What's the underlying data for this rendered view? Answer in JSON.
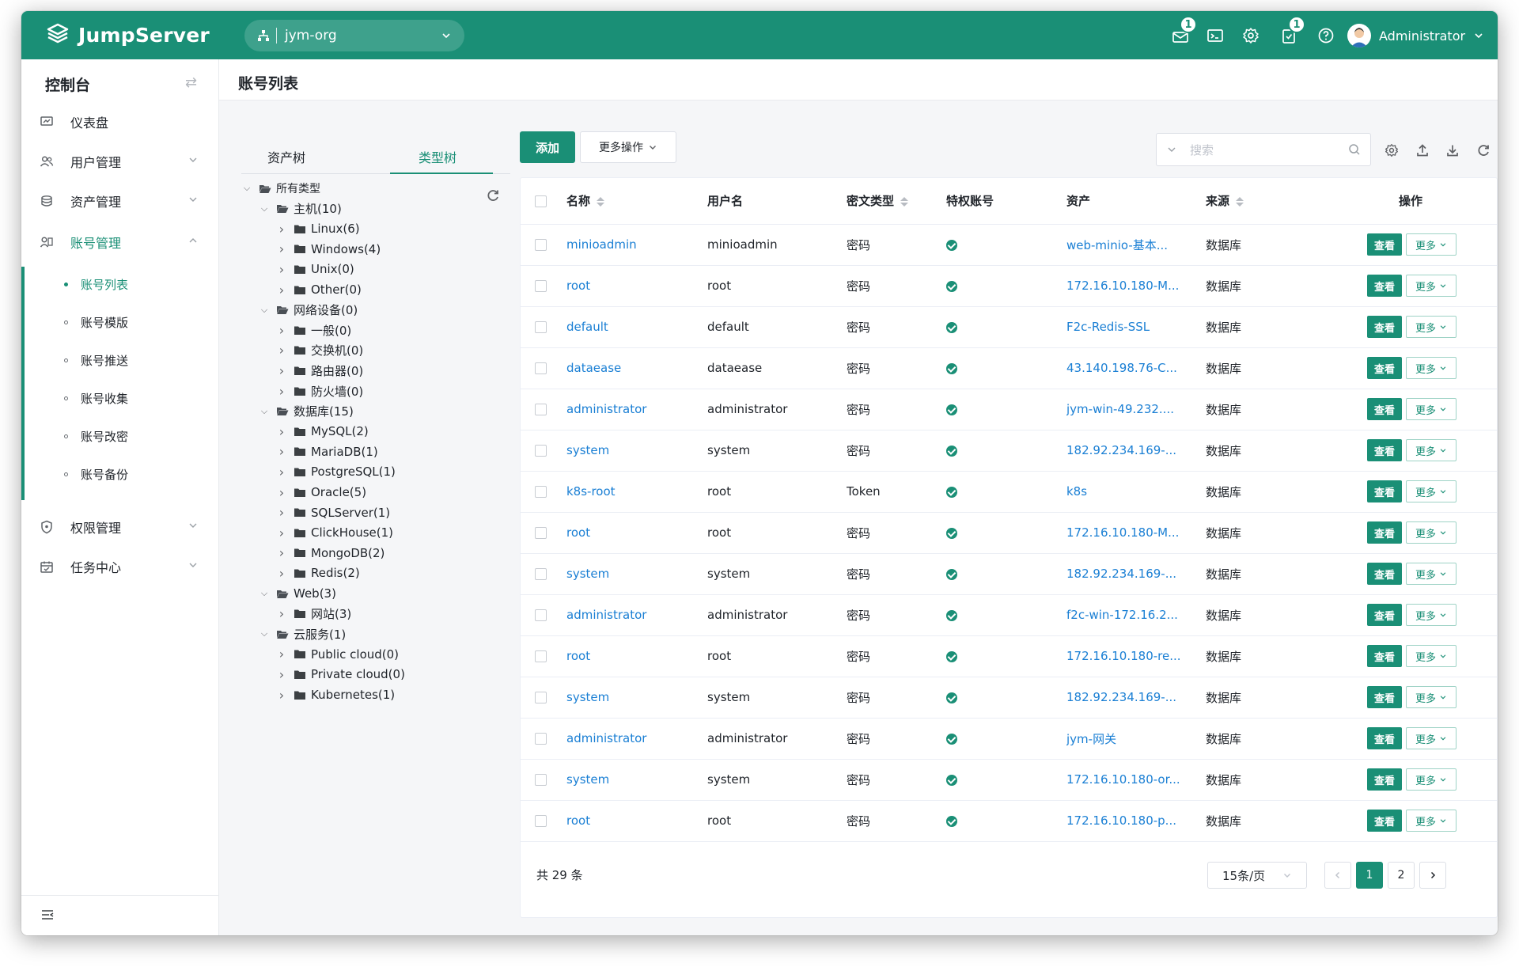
{
  "app": {
    "brand": "JumpServer",
    "org": "jym-org",
    "notifications": {
      "messages_badge": "1",
      "tasks_badge": "1"
    },
    "user": "Administrator",
    "accent": "#1a8f76"
  },
  "sidebar": {
    "title": "控制台",
    "items": [
      {
        "label": "仪表盘",
        "icon": "dashboard-icon"
      },
      {
        "label": "用户管理",
        "icon": "users-icon"
      },
      {
        "label": "资产管理",
        "icon": "assets-icon"
      },
      {
        "label": "账号管理",
        "icon": "accounts-icon"
      },
      {
        "label": "权限管理",
        "icon": "shield-icon"
      },
      {
        "label": "任务中心",
        "icon": "calendar-icon"
      }
    ],
    "account_sub": [
      "账号列表",
      "账号模版",
      "账号推送",
      "账号收集",
      "账号改密",
      "账号备份"
    ],
    "active_sub": "账号列表"
  },
  "page": {
    "title": "账号列表"
  },
  "tree": {
    "tabs": [
      "资产树",
      "类型树"
    ],
    "active_tab": "类型树",
    "nodes": [
      {
        "label": "所有类型",
        "level": 0,
        "expanded": true
      },
      {
        "label": "主机(10)",
        "level": 1,
        "expanded": true
      },
      {
        "label": "Linux(6)",
        "level": 2,
        "expanded": false
      },
      {
        "label": "Windows(4)",
        "level": 2,
        "expanded": false
      },
      {
        "label": "Unix(0)",
        "level": 2,
        "expanded": false
      },
      {
        "label": "Other(0)",
        "level": 2,
        "expanded": false
      },
      {
        "label": "网络设备(0)",
        "level": 1,
        "expanded": true
      },
      {
        "label": "一般(0)",
        "level": 2,
        "expanded": false
      },
      {
        "label": "交换机(0)",
        "level": 2,
        "expanded": false
      },
      {
        "label": "路由器(0)",
        "level": 2,
        "expanded": false
      },
      {
        "label": "防火墙(0)",
        "level": 2,
        "expanded": false
      },
      {
        "label": "数据库(15)",
        "level": 1,
        "expanded": true
      },
      {
        "label": "MySQL(2)",
        "level": 2,
        "expanded": false
      },
      {
        "label": "MariaDB(1)",
        "level": 2,
        "expanded": false
      },
      {
        "label": "PostgreSQL(1)",
        "level": 2,
        "expanded": false
      },
      {
        "label": "Oracle(5)",
        "level": 2,
        "expanded": false
      },
      {
        "label": "SQLServer(1)",
        "level": 2,
        "expanded": false
      },
      {
        "label": "ClickHouse(1)",
        "level": 2,
        "expanded": false
      },
      {
        "label": "MongoDB(2)",
        "level": 2,
        "expanded": false
      },
      {
        "label": "Redis(2)",
        "level": 2,
        "expanded": false
      },
      {
        "label": "Web(3)",
        "level": 1,
        "expanded": true
      },
      {
        "label": "网站(3)",
        "level": 2,
        "expanded": false
      },
      {
        "label": "云服务(1)",
        "level": 1,
        "expanded": true
      },
      {
        "label": "Public cloud(0)",
        "level": 2,
        "expanded": false
      },
      {
        "label": "Private cloud(0)",
        "level": 2,
        "expanded": false
      },
      {
        "label": "Kubernetes(1)",
        "level": 2,
        "expanded": false
      }
    ]
  },
  "toolbar": {
    "add_label": "添加",
    "more_label": "更多操作",
    "search_placeholder": "搜索"
  },
  "table": {
    "columns": [
      "名称",
      "用户名",
      "密文类型",
      "特权账号",
      "资产",
      "来源",
      "操作"
    ],
    "view_label": "查看",
    "more_label": "更多",
    "rows": [
      {
        "name": "minioadmin",
        "username": "minioadmin",
        "secret_type": "密码",
        "asset": "web-minio-基本...",
        "source": "数据库"
      },
      {
        "name": "root",
        "username": "root",
        "secret_type": "密码",
        "asset": "172.16.10.180-M...",
        "source": "数据库"
      },
      {
        "name": "default",
        "username": "default",
        "secret_type": "密码",
        "asset": "F2c-Redis-SSL",
        "source": "数据库"
      },
      {
        "name": "dataease",
        "username": "dataease",
        "secret_type": "密码",
        "asset": "43.140.198.76-C...",
        "source": "数据库"
      },
      {
        "name": "administrator",
        "username": "administrator",
        "secret_type": "密码",
        "asset": "jym-win-49.232....",
        "source": "数据库"
      },
      {
        "name": "system",
        "username": "system",
        "secret_type": "密码",
        "asset": "182.92.234.169-...",
        "source": "数据库"
      },
      {
        "name": "k8s-root",
        "username": "root",
        "secret_type": "Token",
        "asset": "k8s",
        "source": "数据库"
      },
      {
        "name": "root",
        "username": "root",
        "secret_type": "密码",
        "asset": "172.16.10.180-M...",
        "source": "数据库"
      },
      {
        "name": "system",
        "username": "system",
        "secret_type": "密码",
        "asset": "182.92.234.169-...",
        "source": "数据库"
      },
      {
        "name": "administrator",
        "username": "administrator",
        "secret_type": "密码",
        "asset": "f2c-win-172.16.2...",
        "source": "数据库"
      },
      {
        "name": "root",
        "username": "root",
        "secret_type": "密码",
        "asset": "172.16.10.180-re...",
        "source": "数据库"
      },
      {
        "name": "system",
        "username": "system",
        "secret_type": "密码",
        "asset": "182.92.234.169-...",
        "source": "数据库"
      },
      {
        "name": "administrator",
        "username": "administrator",
        "secret_type": "密码",
        "asset": "jym-网关",
        "source": "数据库"
      },
      {
        "name": "system",
        "username": "system",
        "secret_type": "密码",
        "asset": "172.16.10.180-or...",
        "source": "数据库"
      },
      {
        "name": "root",
        "username": "root",
        "secret_type": "密码",
        "asset": "172.16.10.180-p...",
        "source": "数据库"
      }
    ]
  },
  "pagination": {
    "total": "共 29 条",
    "page_size": "15条/页",
    "pages": [
      "1",
      "2"
    ],
    "current": "1"
  }
}
